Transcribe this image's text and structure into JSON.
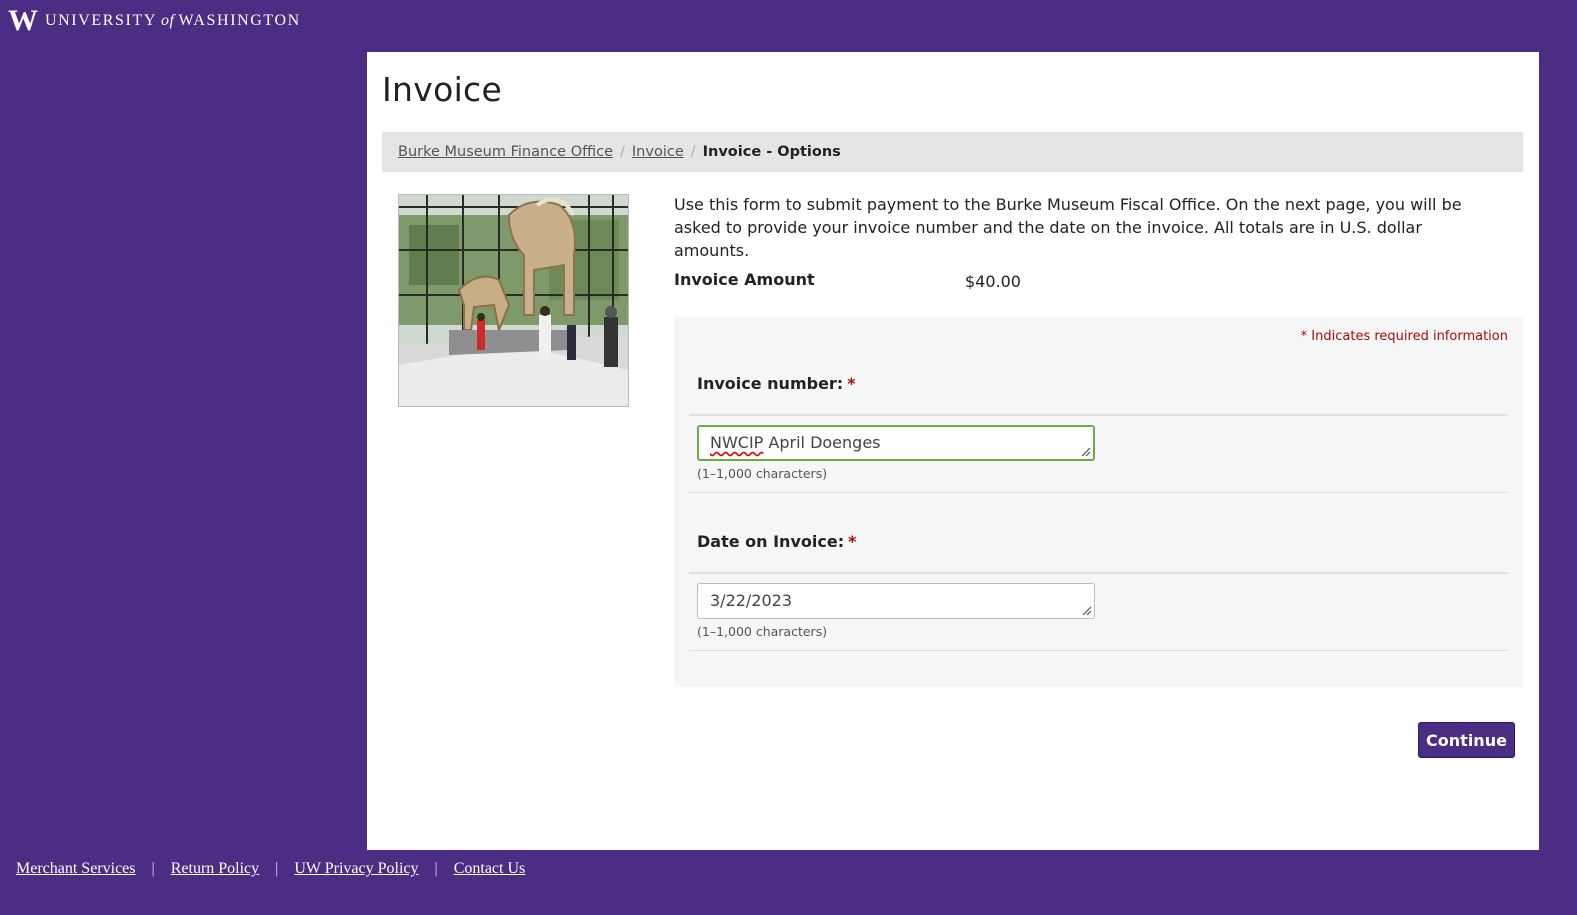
{
  "header": {
    "logo_letter": "W",
    "wordmark_pre": "UNIVERSITY",
    "wordmark_of": "of",
    "wordmark_post": "WASHINGTON"
  },
  "page": {
    "title": "Invoice"
  },
  "breadcrumb": {
    "items": [
      {
        "label": "Burke Museum Finance Office"
      },
      {
        "label": "Invoice"
      },
      {
        "label": "Invoice - Options"
      }
    ],
    "separator": "/"
  },
  "intro_text": "Use this form to submit payment to the Burke Museum Fiscal Office. On the next page, you will be asked to provide your invoice number and the date on the invoice. All totals are in U.S. dollar amounts.",
  "amount": {
    "label": "Invoice Amount",
    "value": "$40.00"
  },
  "form": {
    "required_note": "* Indicates required information",
    "required_mark": "*",
    "fields": [
      {
        "label": "Invoice number:",
        "value_misspelled": "NWCIP",
        "value_rest": " April Doenges",
        "helper": "(1–1,000 characters)"
      },
      {
        "label": "Date on Invoice:",
        "value": "3/22/2023",
        "helper": "(1–1,000 characters)"
      }
    ]
  },
  "actions": {
    "continue_label": "Continue"
  },
  "footer": {
    "links": [
      {
        "label": "Merchant Services"
      },
      {
        "label": "Return Policy"
      },
      {
        "label": "UW Privacy Policy"
      },
      {
        "label": "Contact Us"
      }
    ],
    "separator": "|"
  },
  "colors": {
    "brand_purple": "#4b2e83",
    "required_red": "#a80c0c",
    "focus_green": "#6aaf3d"
  },
  "icons": [
    "uw-w-logo",
    "resize-handle-icon"
  ]
}
